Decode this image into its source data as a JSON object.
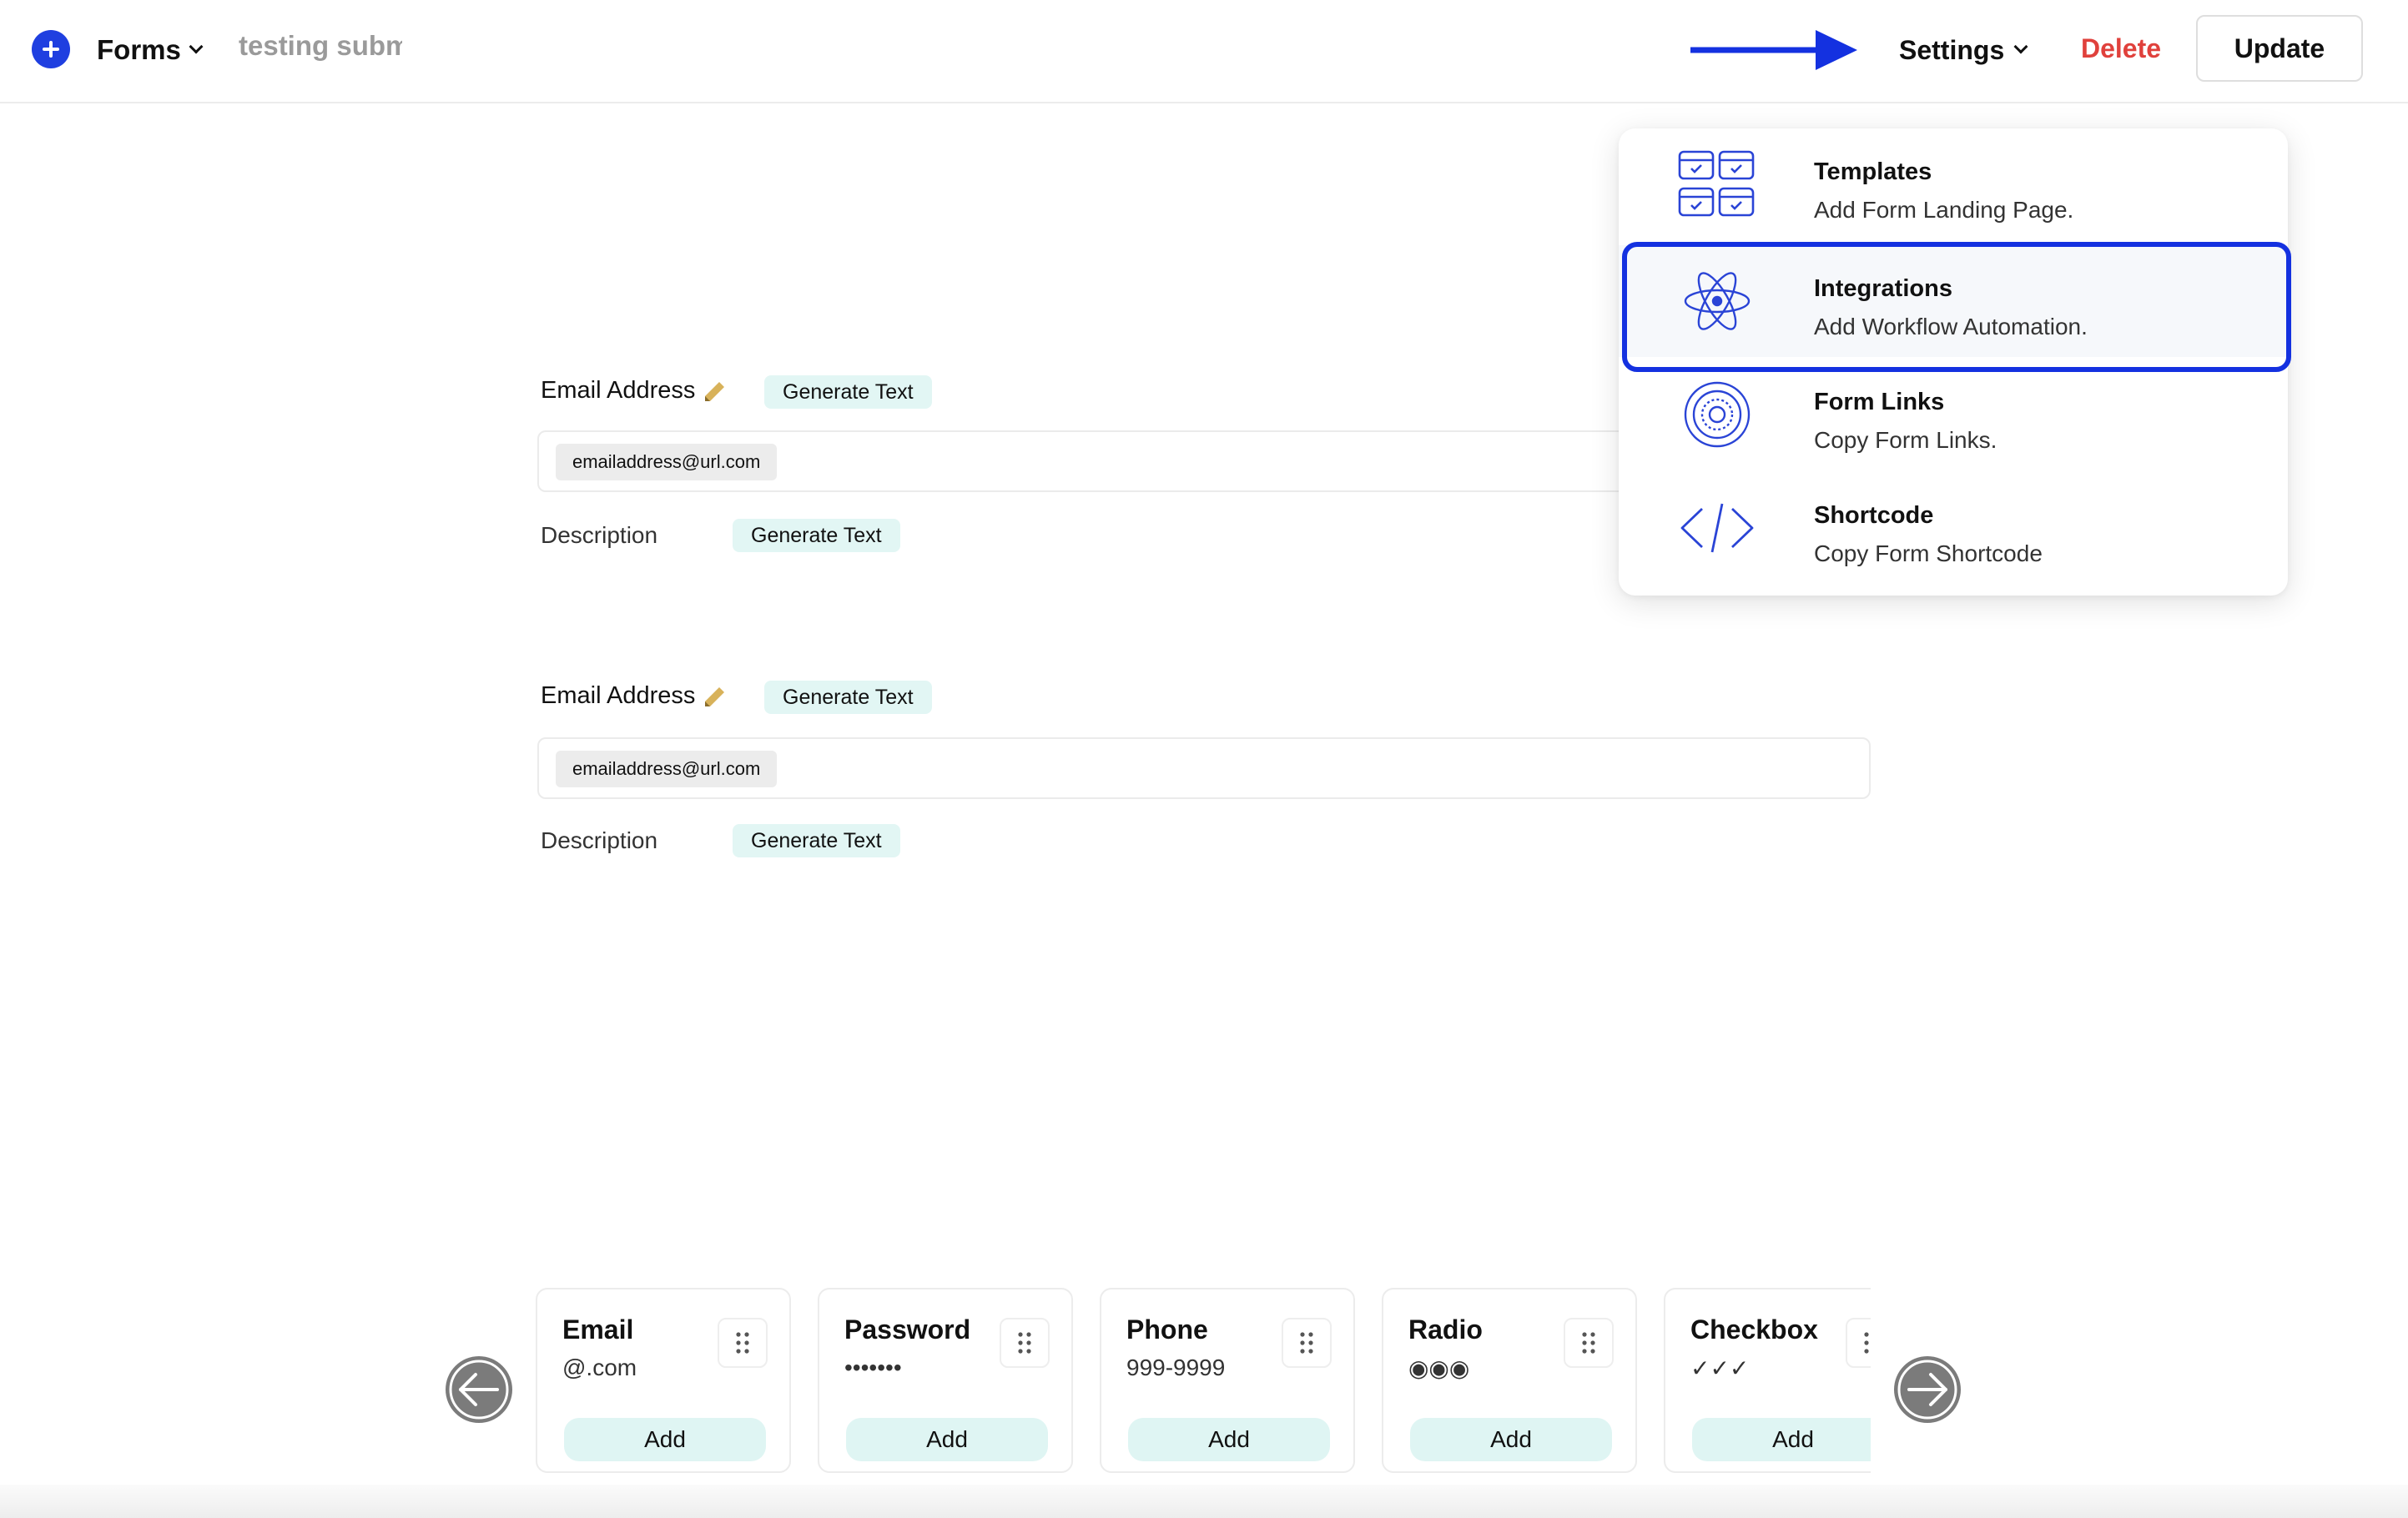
{
  "header": {
    "forms_label": "Forms",
    "form_name": "testing submission",
    "settings_label": "Settings",
    "delete_label": "Delete",
    "update_label": "Update"
  },
  "fields": [
    {
      "label": "Email Address",
      "generate_label": "Generate Text",
      "input_value": "emailaddress@url.com",
      "description_label": "Description",
      "description_generate_label": "Generate Text"
    },
    {
      "label": "Email Address",
      "generate_label": "Generate Text",
      "input_value": "emailaddress@url.com",
      "description_label": "Description",
      "description_generate_label": "Generate Text"
    }
  ],
  "settings_dropdown": {
    "items": [
      {
        "title": "Templates",
        "subtitle": "Add Form Landing Page.",
        "icon": "templates-icon"
      },
      {
        "title": "Integrations",
        "subtitle": "Add Workflow Automation.",
        "icon": "atom-icon",
        "highlighted": true
      },
      {
        "title": "Form Links",
        "subtitle": "Copy Form Links.",
        "icon": "concentric-circles-icon"
      },
      {
        "title": "Shortcode",
        "subtitle": "Copy Form Shortcode",
        "icon": "code-brackets-icon"
      }
    ]
  },
  "field_palette": {
    "add_label": "Add",
    "cards": [
      {
        "title": "Email",
        "sample": "@.com"
      },
      {
        "title": "Password",
        "sample": "•••••••"
      },
      {
        "title": "Phone",
        "sample": "999-9999"
      },
      {
        "title": "Radio",
        "sample": "◉◉◉"
      },
      {
        "title": "Checkbox",
        "sample": "✓✓✓"
      }
    ]
  },
  "colors": {
    "accent": "#1f3fe0",
    "highlight": "#1431e0",
    "delete": "#e0413c",
    "chip": "#e2f6f4"
  }
}
